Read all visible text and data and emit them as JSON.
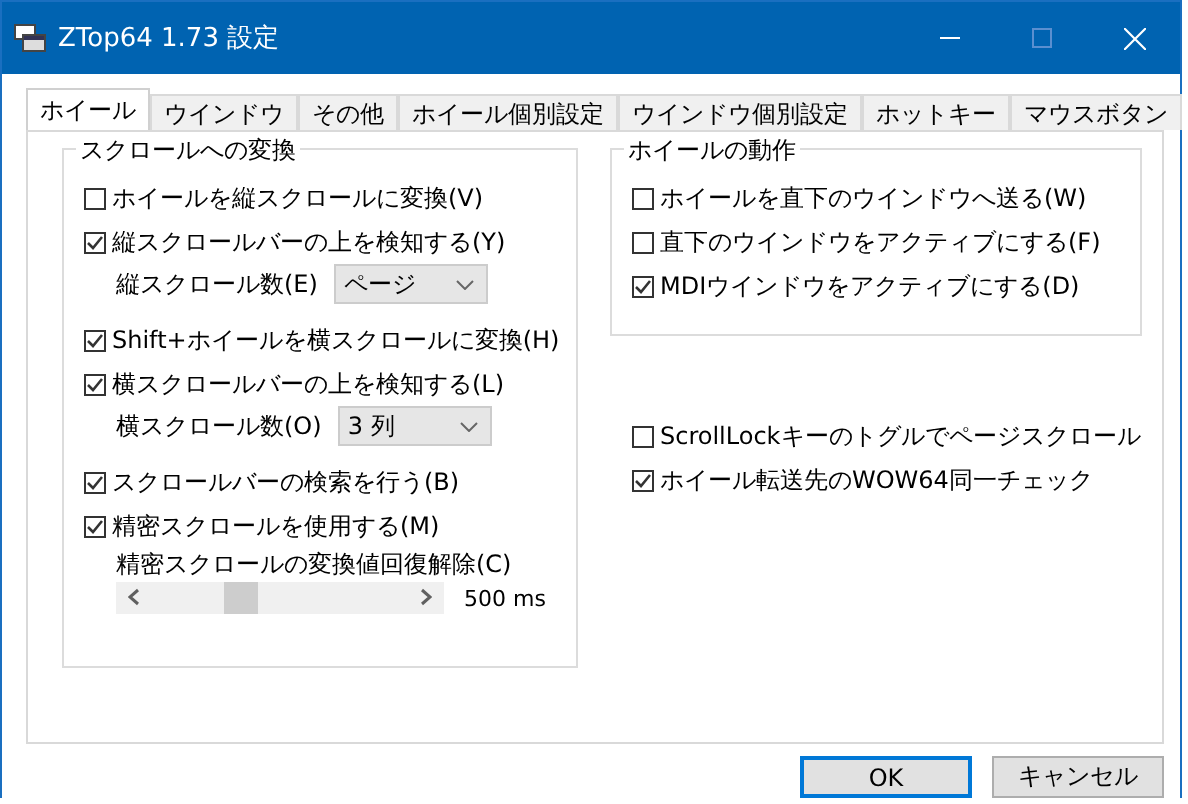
{
  "window": {
    "title": "ZTop64 1.73 設定"
  },
  "tabs": [
    {
      "label": "ホイール",
      "selected": true
    },
    {
      "label": "ウインドウ",
      "selected": false
    },
    {
      "label": "その他",
      "selected": false
    },
    {
      "label": "ホイール個別設定",
      "selected": false
    },
    {
      "label": "ウインドウ個別設定",
      "selected": false
    },
    {
      "label": "ホットキー",
      "selected": false
    },
    {
      "label": "マウスボタン",
      "selected": false
    }
  ],
  "scroll_group": {
    "title": "スクロールへの変換",
    "items": [
      {
        "kind": "checkbox",
        "label": "ホイールを縦スクロールに変換(V)",
        "checked": false
      },
      {
        "kind": "checkbox",
        "label": "縦スクロールバーの上を検知する(Y)",
        "checked": true
      },
      {
        "kind": "dropdown",
        "label": "縦スクロール数(E)",
        "value": "ページ"
      },
      {
        "kind": "checkbox",
        "label": "Shift+ホイールを横スクロールに変換(H)",
        "checked": true
      },
      {
        "kind": "checkbox",
        "label": "横スクロールバーの上を検知する(L)",
        "checked": true
      },
      {
        "kind": "dropdown",
        "label": "横スクロール数(O)",
        "value": "3 列"
      },
      {
        "kind": "checkbox",
        "label": "スクロールバーの検索を行う(B)",
        "checked": true
      },
      {
        "kind": "checkbox",
        "label": "精密スクロールを使用する(M)",
        "checked": true
      },
      {
        "kind": "slider",
        "label": "精密スクロールの変換値回復解除(C)",
        "level": 0.33,
        "reading": "500 ms"
      }
    ]
  },
  "wheel_group": {
    "title": "ホイールの動作",
    "items": [
      {
        "label": "ホイールを直下のウインドウへ送る(W)",
        "checked": false
      },
      {
        "label": "直下のウインドウをアクティブにする(F)",
        "checked": false
      },
      {
        "label": "MDIウインドウをアクティブにする(D)",
        "checked": true
      }
    ]
  },
  "extra_options": [
    {
      "label": "ScrollLockキーのトグルでページスクロール",
      "checked": false
    },
    {
      "label": "ホイール転送先のWOW64同一チェック",
      "checked": true
    }
  ],
  "buttons": [
    {
      "label": "OK",
      "default": true
    },
    {
      "label": "キャンセル",
      "default": false
    }
  ]
}
